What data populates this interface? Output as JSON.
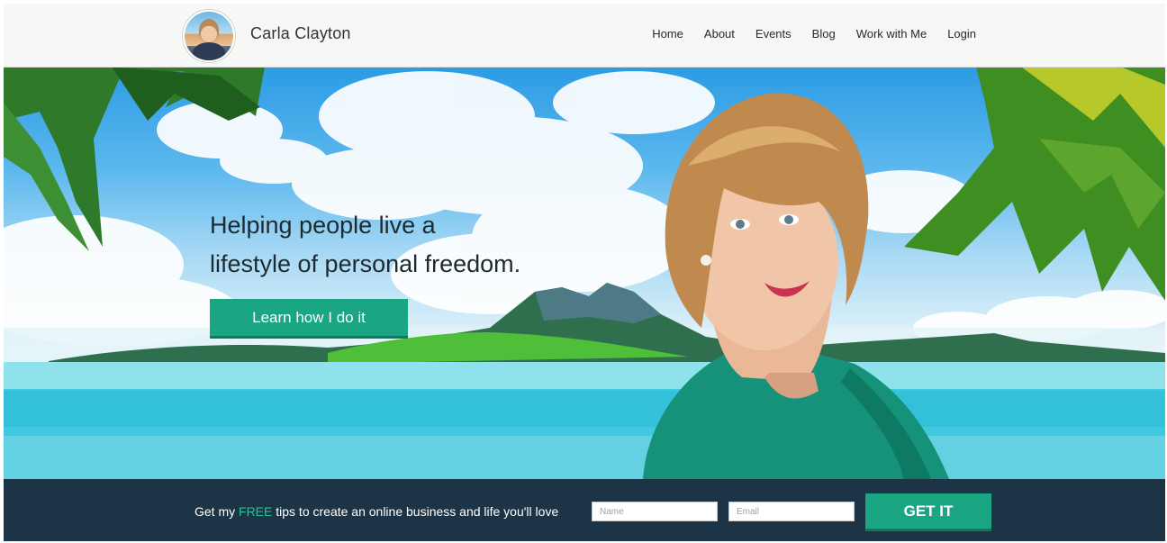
{
  "header": {
    "brand_name": "Carla Clayton",
    "nav": [
      {
        "label": "Home"
      },
      {
        "label": "About"
      },
      {
        "label": "Events"
      },
      {
        "label": "Blog"
      },
      {
        "label": "Work with Me"
      },
      {
        "label": "Login"
      }
    ]
  },
  "hero": {
    "headline_line1": "Helping people live a",
    "headline_line2": "lifestyle of personal freedom.",
    "cta_label": "Learn how I do it"
  },
  "optin": {
    "text_before": "Get my ",
    "text_highlight": "FREE",
    "text_after": " tips to create an online business and life you'll love",
    "name_placeholder": "Name",
    "email_placeholder": "Email",
    "submit_label": "GET IT"
  },
  "colors": {
    "accent": "#1aa682",
    "footer_bg": "#1c3445",
    "highlight": "#29c29a"
  }
}
